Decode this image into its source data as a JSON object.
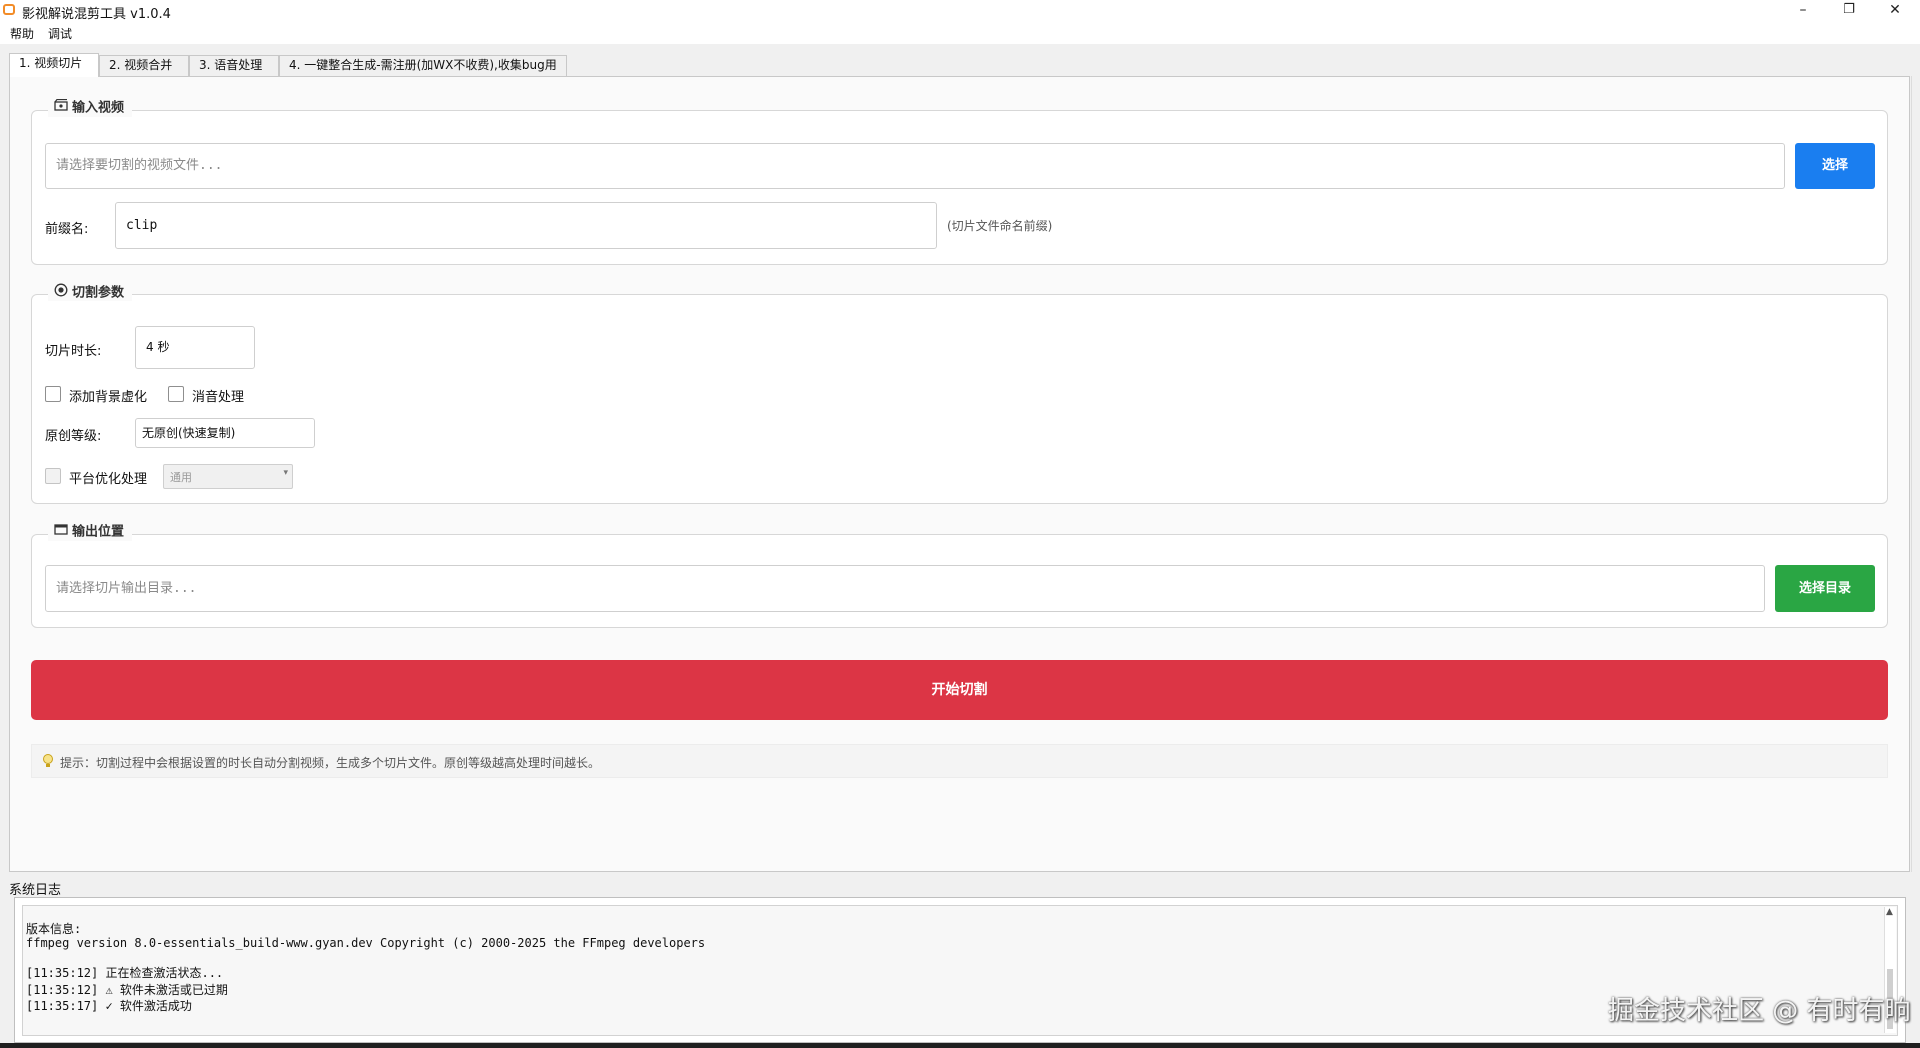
{
  "window": {
    "title": "影视解说混剪工具 v1.0.4",
    "minimize": "–",
    "maximize": "❐",
    "close": "✕"
  },
  "menu": [
    "帮助",
    "调试"
  ],
  "tabs": [
    {
      "label": "1. 视频切片",
      "active": true
    },
    {
      "label": "2. 视频合并",
      "active": false
    },
    {
      "label": "3. 语音处理",
      "active": false
    },
    {
      "label": "4. 一键整合生成-需注册(加WX不收费),收集bug用",
      "active": false
    }
  ],
  "input_group": {
    "title": "输入视频",
    "file_placeholder": "请选择要切割的视频文件...",
    "select_button": "选择",
    "prefix_label": "前缀名:",
    "prefix_value": "clip",
    "prefix_hint": "(切片文件命名前缀)"
  },
  "params_group": {
    "title": "切割参数",
    "duration_label": "切片时长:",
    "duration_value": "4 秒",
    "bg_blur_label": "添加背景虚化",
    "mute_label": "消音处理",
    "level_label": "原创等级:",
    "level_value": "无原创(快速复制)",
    "platform_label": "平台优化处理",
    "platform_value": "通用"
  },
  "output_group": {
    "title": "输出位置",
    "dir_placeholder": "请选择切片输出目录...",
    "select_dir_button": "选择目录"
  },
  "start_button": "开始切割",
  "tip": "提示：切割过程中会根据设置的时长自动分割视频，生成多个切片文件。原创等级越高处理时间越长。",
  "log": {
    "label": "系统日志",
    "lines": [
      "版本信息:",
      "ffmpeg version 8.0-essentials_build-www.gyan.dev Copyright (c) 2000-2025 the FFmpeg developers",
      "",
      "[11:35:12] 正在检查激活状态...",
      "[11:35:12] ⚠ 软件未激活或已过期",
      "[11:35:17] ✓ 软件激活成功"
    ]
  },
  "watermark": "掘金技术社区 @ 有时有晌",
  "colors": {
    "blue_button": "#1a7ef0",
    "green_button": "#2aa644",
    "red_button": "#dc3545",
    "app_icon": "#f28c28"
  }
}
